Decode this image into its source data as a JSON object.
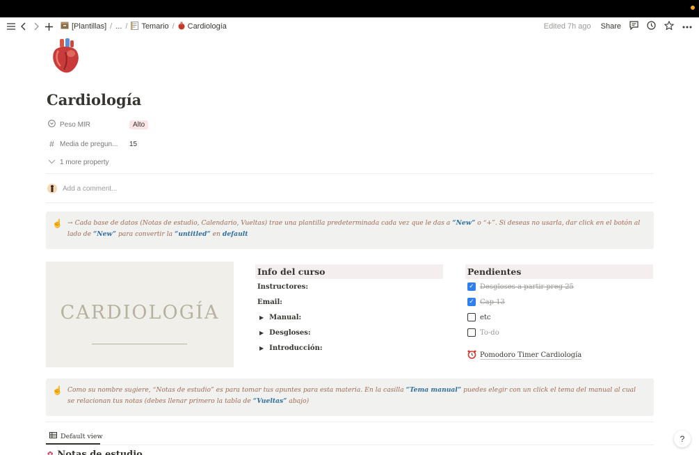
{
  "topbar": {
    "breadcrumbs": [
      {
        "label": "[Plantillas]",
        "icon": "folder-box-icon"
      },
      {
        "label": "..."
      },
      {
        "label": "Temario",
        "icon": "notebook-icon"
      },
      {
        "label": "Cardiología",
        "icon": "heart-icon"
      }
    ],
    "edited": "Edited 7h ago",
    "share": "Share"
  },
  "page": {
    "icon": "anatomical-heart-icon",
    "title": "Cardiología",
    "properties": [
      {
        "name": "Peso MIR",
        "value": "Alto",
        "icon": "select-icon"
      },
      {
        "name": "Media de pregun...",
        "value": "15",
        "icon": "number-icon"
      }
    ],
    "more_properties": "1 more property",
    "comment_placeholder": "Add a comment..."
  },
  "callout1": {
    "t1": "→ Cada base de datos (Notas de estudio, Calendario, Vueltas) trae una plantilla predeterminada cada vez que le das a ",
    "b1": "“New”",
    "t2": " o “+”. Si deseas no usarla, dar click en el botón al lado de ",
    "b2": "“New”",
    "t3": " para convertir la ",
    "b3": "“untitled”",
    "t4": " en ",
    "b4": "default"
  },
  "banner": {
    "text": "CARDIOLOGÍA"
  },
  "info": {
    "heading": "Info del curso",
    "instructores": "Instructores:",
    "email": "Email:",
    "toggles": [
      "Manual:",
      "Desgloses:",
      "Introducción:"
    ]
  },
  "pendientes": {
    "heading": "Pendientes",
    "todos": [
      {
        "label": "Desgloses a partir preg 25",
        "checked": true
      },
      {
        "label": "Cap 13",
        "checked": true
      },
      {
        "label": "etc",
        "checked": false
      },
      {
        "label": "To-do",
        "checked": false,
        "placeholder": true
      }
    ],
    "link": "Pomodoro Timer Cardiología"
  },
  "callout2": {
    "t1": "Como su nombre sugiere, “Notas de estudio” es para tomar tus apuntes para esta materia. En la casilla ",
    "b1": "“Tema manual”",
    "t2": " puedes elegir con un click el tema del manual al cual se relacionan tus notas (debes llenar primero la tabla de ",
    "b2": "“Vueltas”",
    "t3": " abajo)"
  },
  "database": {
    "view": "Default view",
    "title": "Notas de estudio"
  },
  "help": "?"
}
